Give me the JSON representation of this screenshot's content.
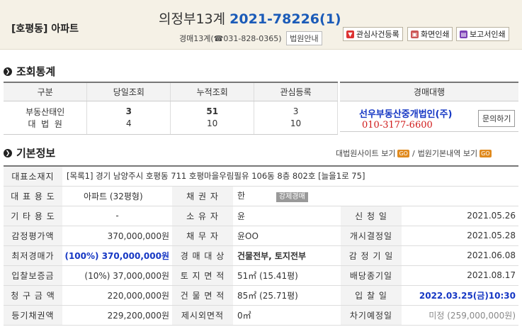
{
  "header": {
    "location": "[호평동] 아파트",
    "case_prefix": "의정부13계",
    "case_number": "2021-78226(1)",
    "contact": "경매13계(☎031-828-0365)",
    "court_info_btn": "법원안내",
    "buttons": {
      "interest": "관심사건등록",
      "print_screen": "화면인쇄",
      "print_report": "보고서인쇄"
    }
  },
  "stats": {
    "title": "조회통계",
    "headers": [
      "구분",
      "당일조회",
      "누적조회",
      "관심등록"
    ],
    "rows": [
      [
        "부동산태인",
        "3",
        "51",
        "3"
      ],
      [
        "대  법  원",
        "4",
        "10",
        "10"
      ]
    ]
  },
  "agent": {
    "header": "경매대행",
    "name": "선우부동산중개법인(주)",
    "phone": "010-3177-6600",
    "inquiry_btn": "문의하기"
  },
  "basic": {
    "title": "기본정보",
    "link1": "대법원사이트 보기",
    "link2": "법원기본내역 보기",
    "go": "GO",
    "address_label": "대표소재지",
    "address": "[목록1] 경기 남양주시 호평동 711 호평마을우림필유 106동 8층 802호 [늘을1로 75]",
    "rows": [
      {
        "l1": "대 표 용 도",
        "v1": "아파트 (32평형)",
        "l2": "채 권 자",
        "v2": "한",
        "badge": "강제경매"
      },
      {
        "l1": "기 타 용 도",
        "v1": "-",
        "l2": "소 유 자",
        "v2": "윤",
        "l3": "신 청 일",
        "v3": "2021.05.26"
      },
      {
        "l1": "감정평가액",
        "v1": "370,000,000원",
        "l2": "채 무 자",
        "v2": "윤OO",
        "l3": "개시결정일",
        "v3": "2021.05.28"
      },
      {
        "l1": "최저경매가",
        "v1": "(100%) 370,000,000원",
        "l2": "경 매 대 상",
        "v2": "건물전부, 토지전부",
        "l3": "감 정 기 일",
        "v3": "2021.06.08"
      },
      {
        "l1": "입찰보증금",
        "v1": "(10%) 37,000,000원",
        "l2": "토 지 면 적",
        "v2": "51㎡ (15.41평)",
        "l3": "배당종기일",
        "v3": "2021.08.17"
      },
      {
        "l1": "청 구 금 액",
        "v1": "220,000,000원",
        "l2": "건 물 면 적",
        "v2": "85㎡ (25.71평)",
        "l3": "입 찰 일",
        "v3": "2022.03.25(금)10:30"
      },
      {
        "l1": "등기채권액",
        "v1": "229,200,000원",
        "l2": "제시외면적",
        "v2": "0㎡",
        "l3": "차기예정일",
        "v3": "미정 (259,000,000원)"
      }
    ]
  }
}
